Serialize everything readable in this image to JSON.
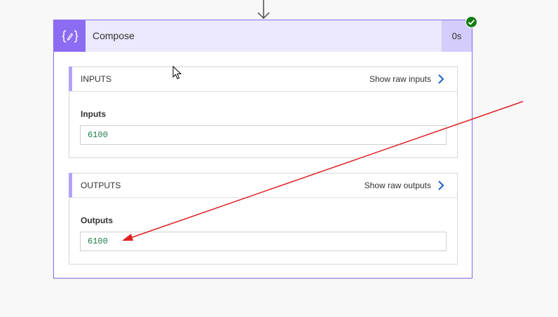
{
  "action": {
    "title": "Compose",
    "duration": "0s",
    "icon": "compose-braces-icon",
    "status": "succeeded"
  },
  "inputs": {
    "section_title": "INPUTS",
    "raw_link": "Show raw inputs",
    "field_label": "Inputs",
    "field_value": "6100"
  },
  "outputs": {
    "section_title": "OUTPUTS",
    "raw_link": "Show raw outputs",
    "field_label": "Outputs",
    "field_value": "6100"
  },
  "colors": {
    "accent": "#8b6cf2",
    "header_bg": "#ece8fd",
    "success": "#107c10",
    "link_chevron": "#1a5fc8",
    "value_text": "#1c7a4a",
    "annotation_arrow": "#e02020"
  }
}
